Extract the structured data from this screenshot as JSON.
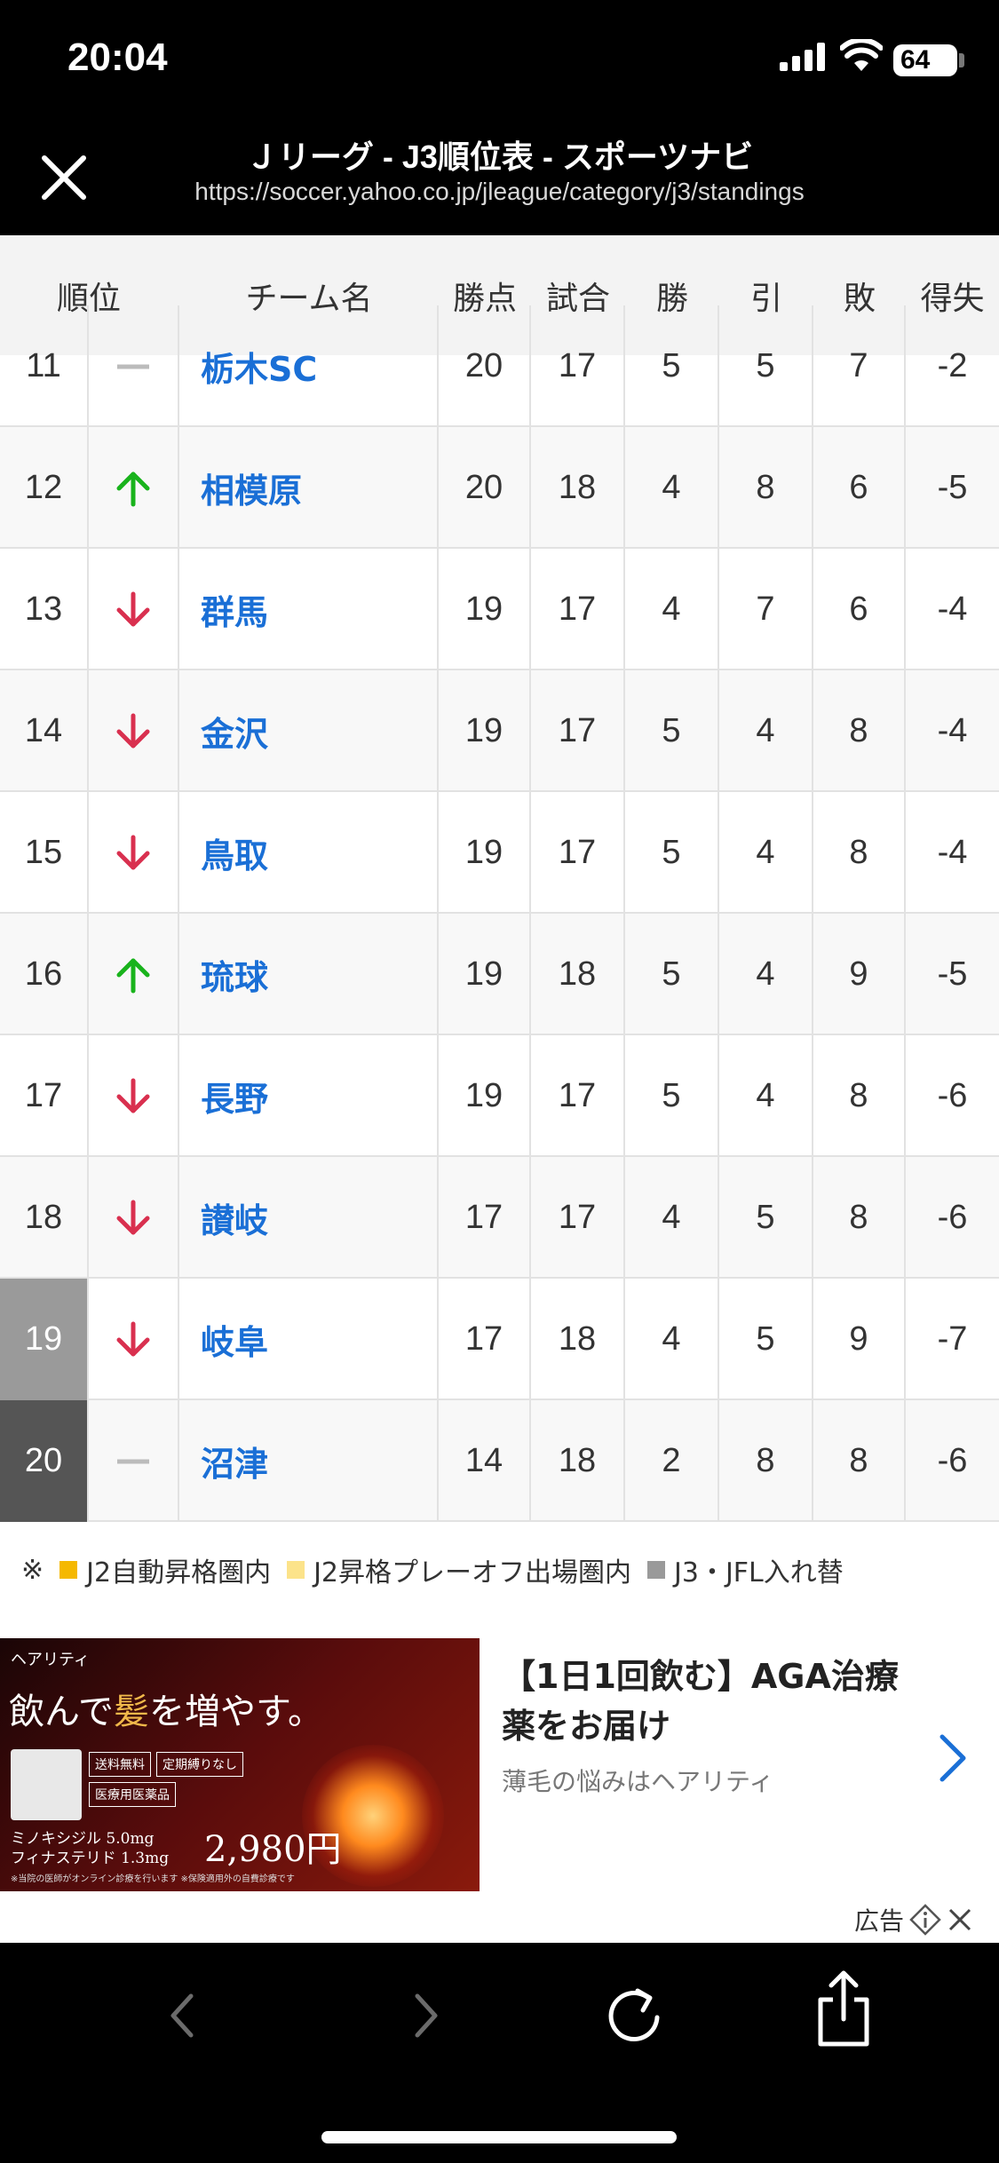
{
  "status": {
    "time": "20:04",
    "battery": "64"
  },
  "nav": {
    "title": "Ｊリーグ - J3順位表 - スポーツナビ",
    "url": "https://soccer.yahoo.co.jp/jleague/category/j3/standings"
  },
  "table": {
    "headers": {
      "rank": "順位",
      "team": "チーム名",
      "points": "勝点",
      "played": "試合",
      "wins": "勝",
      "draws": "引",
      "losses": "敗",
      "gd": "得失"
    },
    "rows": [
      {
        "rank": "11",
        "trend": "same",
        "team": "栃木SC",
        "points": "20",
        "played": "17",
        "wins": "5",
        "draws": "5",
        "losses": "7",
        "gd": "-2"
      },
      {
        "rank": "12",
        "trend": "up",
        "team": "相模原",
        "points": "20",
        "played": "18",
        "wins": "4",
        "draws": "8",
        "losses": "6",
        "gd": "-5"
      },
      {
        "rank": "13",
        "trend": "down",
        "team": "群馬",
        "points": "19",
        "played": "17",
        "wins": "4",
        "draws": "7",
        "losses": "6",
        "gd": "-4"
      },
      {
        "rank": "14",
        "trend": "down",
        "team": "金沢",
        "points": "19",
        "played": "17",
        "wins": "5",
        "draws": "4",
        "losses": "8",
        "gd": "-4"
      },
      {
        "rank": "15",
        "trend": "down",
        "team": "鳥取",
        "points": "19",
        "played": "17",
        "wins": "5",
        "draws": "4",
        "losses": "8",
        "gd": "-4"
      },
      {
        "rank": "16",
        "trend": "up",
        "team": "琉球",
        "points": "19",
        "played": "18",
        "wins": "5",
        "draws": "4",
        "losses": "9",
        "gd": "-5"
      },
      {
        "rank": "17",
        "trend": "down",
        "team": "長野",
        "points": "19",
        "played": "17",
        "wins": "5",
        "draws": "4",
        "losses": "8",
        "gd": "-6"
      },
      {
        "rank": "18",
        "trend": "down",
        "team": "讃岐",
        "points": "17",
        "played": "17",
        "wins": "4",
        "draws": "5",
        "losses": "8",
        "gd": "-6"
      },
      {
        "rank": "19",
        "trend": "down",
        "team": "岐阜",
        "points": "17",
        "played": "18",
        "wins": "4",
        "draws": "5",
        "losses": "9",
        "gd": "-7"
      },
      {
        "rank": "20",
        "trend": "same",
        "team": "沼津",
        "points": "14",
        "played": "18",
        "wins": "2",
        "draws": "8",
        "losses": "8",
        "gd": "-6"
      }
    ]
  },
  "legend": {
    "prefix": "※",
    "items": [
      {
        "label": "J2自動昇格圏内",
        "color": "#f5b800"
      },
      {
        "label": "J2昇格プレーオフ出場圏内",
        "color": "#fce38a"
      },
      {
        "label": "J3・JFL入れ替",
        "color": "#9a9a9a"
      }
    ]
  },
  "ad": {
    "brand": "ヘアリティ",
    "headline_a": "飲んで",
    "headline_b": "髪",
    "headline_c": "を増やす。",
    "tags": [
      "送料無料",
      "定期縛りなし",
      "医療用医薬品"
    ],
    "spec1": "ミノキシジル 5.0mg",
    "spec2": "フィナステリド 1.3mg",
    "price": "2,980円",
    "note": "※当院の医師がオンライン診療を行います ※保険適用外の自費診療です",
    "title": "【1日1回飲む】AGA治療薬をお届け",
    "subtitle": "薄毛の悩みはヘアリティ",
    "label": "広告"
  },
  "colors": {
    "link": "#1a6fd6",
    "up": "#19b31c",
    "down": "#d9304f",
    "same": "#bbbbbb"
  }
}
